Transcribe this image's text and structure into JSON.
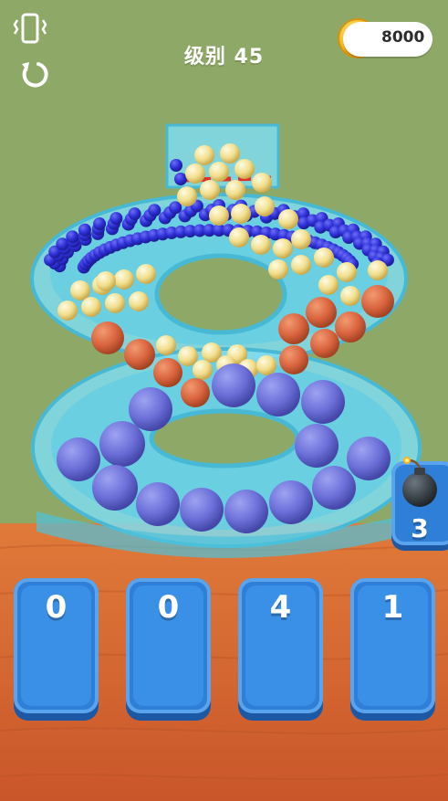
{
  "hud": {
    "level_label": "级别",
    "level_number": "45",
    "coins": "8000",
    "vibration_icon": "phone-vibrate-icon",
    "restart_icon": "restart-icon"
  },
  "cards": [
    {
      "count": "0",
      "ball": "purple-ball"
    },
    {
      "count": "0",
      "ball": "orange-ball"
    },
    {
      "count": "4",
      "ball": "yellow-ball"
    },
    {
      "count": "1",
      "ball": "blue-ball"
    }
  ],
  "bomb": {
    "count": "3",
    "icon": "bomb-icon"
  },
  "colors": {
    "background": "#8ea967",
    "table": "#d86a2e",
    "container": "#5fd0e6",
    "card": "#2f7fd9",
    "purple_ball": "#6b6fd8",
    "orange_ball": "#d9643e",
    "yellow_ball": "#f1de8c",
    "blue_ball": "#2d2fd6",
    "limit_line": "#e0322a"
  }
}
